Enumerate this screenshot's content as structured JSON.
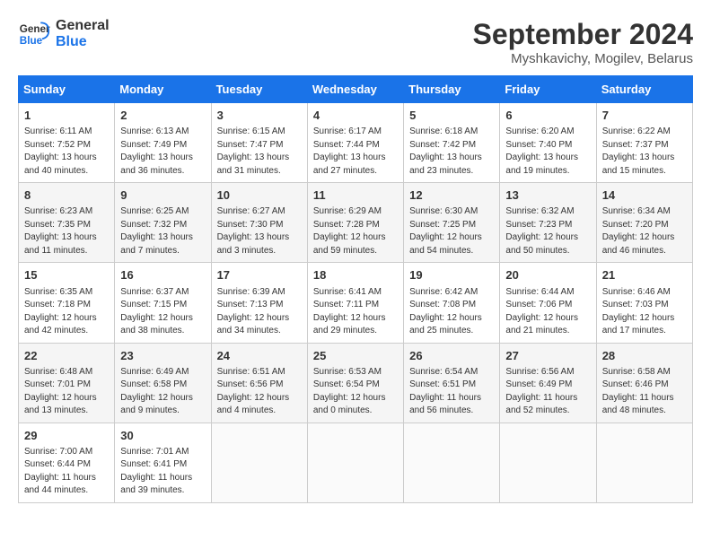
{
  "header": {
    "logo_line1": "General",
    "logo_line2": "Blue",
    "month_title": "September 2024",
    "location": "Myshkavichy, Mogilev, Belarus"
  },
  "weekdays": [
    "Sunday",
    "Monday",
    "Tuesday",
    "Wednesday",
    "Thursday",
    "Friday",
    "Saturday"
  ],
  "weeks": [
    [
      {
        "day": "1",
        "info": "Sunrise: 6:11 AM\nSunset: 7:52 PM\nDaylight: 13 hours\nand 40 minutes."
      },
      {
        "day": "2",
        "info": "Sunrise: 6:13 AM\nSunset: 7:49 PM\nDaylight: 13 hours\nand 36 minutes."
      },
      {
        "day": "3",
        "info": "Sunrise: 6:15 AM\nSunset: 7:47 PM\nDaylight: 13 hours\nand 31 minutes."
      },
      {
        "day": "4",
        "info": "Sunrise: 6:17 AM\nSunset: 7:44 PM\nDaylight: 13 hours\nand 27 minutes."
      },
      {
        "day": "5",
        "info": "Sunrise: 6:18 AM\nSunset: 7:42 PM\nDaylight: 13 hours\nand 23 minutes."
      },
      {
        "day": "6",
        "info": "Sunrise: 6:20 AM\nSunset: 7:40 PM\nDaylight: 13 hours\nand 19 minutes."
      },
      {
        "day": "7",
        "info": "Sunrise: 6:22 AM\nSunset: 7:37 PM\nDaylight: 13 hours\nand 15 minutes."
      }
    ],
    [
      {
        "day": "8",
        "info": "Sunrise: 6:23 AM\nSunset: 7:35 PM\nDaylight: 13 hours\nand 11 minutes."
      },
      {
        "day": "9",
        "info": "Sunrise: 6:25 AM\nSunset: 7:32 PM\nDaylight: 13 hours\nand 7 minutes."
      },
      {
        "day": "10",
        "info": "Sunrise: 6:27 AM\nSunset: 7:30 PM\nDaylight: 13 hours\nand 3 minutes."
      },
      {
        "day": "11",
        "info": "Sunrise: 6:29 AM\nSunset: 7:28 PM\nDaylight: 12 hours\nand 59 minutes."
      },
      {
        "day": "12",
        "info": "Sunrise: 6:30 AM\nSunset: 7:25 PM\nDaylight: 12 hours\nand 54 minutes."
      },
      {
        "day": "13",
        "info": "Sunrise: 6:32 AM\nSunset: 7:23 PM\nDaylight: 12 hours\nand 50 minutes."
      },
      {
        "day": "14",
        "info": "Sunrise: 6:34 AM\nSunset: 7:20 PM\nDaylight: 12 hours\nand 46 minutes."
      }
    ],
    [
      {
        "day": "15",
        "info": "Sunrise: 6:35 AM\nSunset: 7:18 PM\nDaylight: 12 hours\nand 42 minutes."
      },
      {
        "day": "16",
        "info": "Sunrise: 6:37 AM\nSunset: 7:15 PM\nDaylight: 12 hours\nand 38 minutes."
      },
      {
        "day": "17",
        "info": "Sunrise: 6:39 AM\nSunset: 7:13 PM\nDaylight: 12 hours\nand 34 minutes."
      },
      {
        "day": "18",
        "info": "Sunrise: 6:41 AM\nSunset: 7:11 PM\nDaylight: 12 hours\nand 29 minutes."
      },
      {
        "day": "19",
        "info": "Sunrise: 6:42 AM\nSunset: 7:08 PM\nDaylight: 12 hours\nand 25 minutes."
      },
      {
        "day": "20",
        "info": "Sunrise: 6:44 AM\nSunset: 7:06 PM\nDaylight: 12 hours\nand 21 minutes."
      },
      {
        "day": "21",
        "info": "Sunrise: 6:46 AM\nSunset: 7:03 PM\nDaylight: 12 hours\nand 17 minutes."
      }
    ],
    [
      {
        "day": "22",
        "info": "Sunrise: 6:48 AM\nSunset: 7:01 PM\nDaylight: 12 hours\nand 13 minutes."
      },
      {
        "day": "23",
        "info": "Sunrise: 6:49 AM\nSunset: 6:58 PM\nDaylight: 12 hours\nand 9 minutes."
      },
      {
        "day": "24",
        "info": "Sunrise: 6:51 AM\nSunset: 6:56 PM\nDaylight: 12 hours\nand 4 minutes."
      },
      {
        "day": "25",
        "info": "Sunrise: 6:53 AM\nSunset: 6:54 PM\nDaylight: 12 hours\nand 0 minutes."
      },
      {
        "day": "26",
        "info": "Sunrise: 6:54 AM\nSunset: 6:51 PM\nDaylight: 11 hours\nand 56 minutes."
      },
      {
        "day": "27",
        "info": "Sunrise: 6:56 AM\nSunset: 6:49 PM\nDaylight: 11 hours\nand 52 minutes."
      },
      {
        "day": "28",
        "info": "Sunrise: 6:58 AM\nSunset: 6:46 PM\nDaylight: 11 hours\nand 48 minutes."
      }
    ],
    [
      {
        "day": "29",
        "info": "Sunrise: 7:00 AM\nSunset: 6:44 PM\nDaylight: 11 hours\nand 44 minutes."
      },
      {
        "day": "30",
        "info": "Sunrise: 7:01 AM\nSunset: 6:41 PM\nDaylight: 11 hours\nand 39 minutes."
      },
      {
        "day": "",
        "info": ""
      },
      {
        "day": "",
        "info": ""
      },
      {
        "day": "",
        "info": ""
      },
      {
        "day": "",
        "info": ""
      },
      {
        "day": "",
        "info": ""
      }
    ]
  ]
}
